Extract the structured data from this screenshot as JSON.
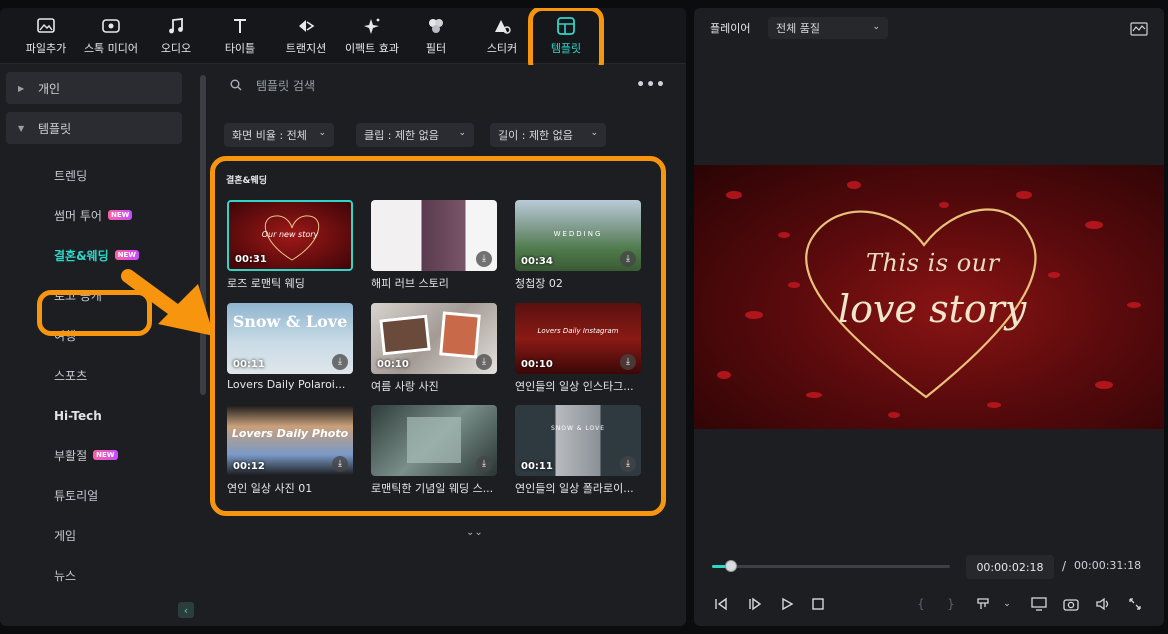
{
  "toolbar": {
    "items": [
      {
        "label": "파일추가",
        "icon": "import-media-icon"
      },
      {
        "label": "스톡 미디어",
        "icon": "stock-media-icon"
      },
      {
        "label": "오디오",
        "icon": "music-note-icon"
      },
      {
        "label": "타이틀",
        "icon": "text-t-icon"
      },
      {
        "label": "트랜지션",
        "icon": "transition-icon"
      },
      {
        "label": "이펙트 효과",
        "icon": "effects-sparkle-icon"
      },
      {
        "label": "필터",
        "icon": "filter-circles-icon"
      },
      {
        "label": "스티커",
        "icon": "sticker-icon"
      },
      {
        "label": "템플릿",
        "icon": "template-icon"
      }
    ],
    "active": "템플릿"
  },
  "sidebar": {
    "groups": [
      {
        "label": "개인",
        "expanded": false
      },
      {
        "label": "템플릿",
        "expanded": true
      }
    ],
    "items": [
      {
        "label": "트렌딩",
        "badge": ""
      },
      {
        "label": "썸머 투어",
        "badge": "NEW"
      },
      {
        "label": "결혼&웨딩",
        "badge": "NEW"
      },
      {
        "label": "로고 공개",
        "badge": ""
      },
      {
        "label": "여행",
        "badge": ""
      },
      {
        "label": "스포츠",
        "badge": ""
      },
      {
        "label": "Hi-Tech",
        "badge": ""
      },
      {
        "label": "부활절",
        "badge": "NEW"
      },
      {
        "label": "튜토리얼",
        "badge": ""
      },
      {
        "label": "게임",
        "badge": ""
      },
      {
        "label": "뉴스",
        "badge": ""
      }
    ],
    "active": "결혼&웨딩"
  },
  "content": {
    "search_placeholder": "템플릿 검색",
    "filters": [
      {
        "label": "화면 비율 : 전체"
      },
      {
        "label": "클립 : 제한 없음"
      },
      {
        "label": "길이 : 제한 없음"
      }
    ],
    "section_title": "결혼&웨딩",
    "templates": [
      {
        "title": "로즈 로맨틱 웨딩",
        "duration": "00:31",
        "overlay": "Our new story",
        "download": false,
        "selected": true
      },
      {
        "title": "해피 러브 스토리",
        "duration": "",
        "overlay": "",
        "download": true,
        "selected": false
      },
      {
        "title": "청첩장 02",
        "duration": "00:34",
        "overlay": "WEDDING",
        "download": true,
        "selected": false
      },
      {
        "title": "Lovers Daily Polaroi...",
        "duration": "00:11",
        "overlay": "Snow & Love",
        "download": true,
        "selected": false
      },
      {
        "title": "여름 사랑 사진",
        "duration": "00:10",
        "overlay": "",
        "download": true,
        "selected": false
      },
      {
        "title": "연인들의 일상 인스타그...",
        "duration": "00:10",
        "overlay": "Lovers Daily Instagram",
        "download": true,
        "selected": false
      },
      {
        "title": "연인 일상 사진 01",
        "duration": "00:12",
        "overlay": "Lovers Daily Photo",
        "download": true,
        "selected": false
      },
      {
        "title": "로맨틱한 기념일 웨딩 스...",
        "duration": "",
        "overlay": "",
        "download": true,
        "selected": false
      },
      {
        "title": "연인들의 일상 폴라로이...",
        "duration": "00:11",
        "overlay": "SNOW & LOVE",
        "download": true,
        "selected": false
      }
    ]
  },
  "player": {
    "title": "플레이어",
    "quality": "전체 품질",
    "preview_line1": "This is our",
    "preview_line2": "love story",
    "current_time": "00:00:02:18",
    "separator": "/",
    "total_time": "00:00:31:18",
    "progress": 0.08
  },
  "colors": {
    "accent": "#2fd6c8",
    "highlight": "#f7960e",
    "badge": "#ff5fa0",
    "panel": "#1c1e22"
  }
}
